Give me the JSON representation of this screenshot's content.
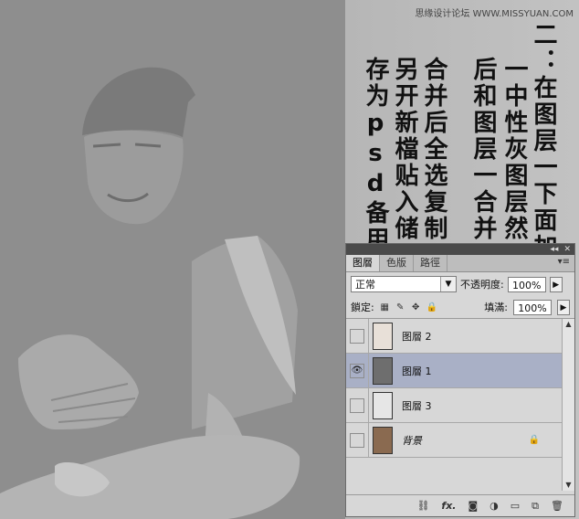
{
  "watermark": "思缘设计论坛 WWW.MISSYUAN.COM",
  "instructions": {
    "col1": "二：在图层一下面加",
    "col2": "一中性灰图层然",
    "col3": "后和图层一合并",
    "col4": "合并后全选复制",
    "col5": "另开新檔贴入储",
    "col6": "存为psd备用"
  },
  "panel": {
    "tabs": [
      "图層",
      "色版",
      "路徑"
    ],
    "blend_mode": "正常",
    "opacity_label": "不透明度:",
    "opacity_value": "100%",
    "lock_label": "鎖定:",
    "fill_label": "填滿:",
    "fill_value": "100%",
    "layers": [
      {
        "name": "图層 2",
        "visible": false,
        "selected": false
      },
      {
        "name": "图層 1",
        "visible": true,
        "selected": true
      },
      {
        "name": "图層 3",
        "visible": false,
        "selected": false
      },
      {
        "name": "背景",
        "visible": false,
        "selected": false,
        "locked": true
      }
    ]
  },
  "colors": {
    "canvas": "#8c8c8c",
    "selected_layer": "#a9b0c6"
  }
}
